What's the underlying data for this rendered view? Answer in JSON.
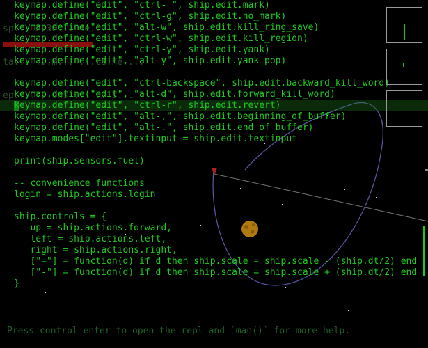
{
  "hud": {
    "lines": [
      "sp... 2.38... 4e...",
      "ta... ...m... ...ta.ne ...",
      "ep.......ons ... ...s..."
    ]
  },
  "editor": {
    "lines": [
      "keymap.define(\"edit\", \"ctrl- \", ship.edit.mark)",
      "keymap.define(\"edit\", \"ctrl-g\", ship.edit.no_mark)",
      "keymap.define(\"edit\", \"alt-w\", ship.edit.kill_ring_save)",
      "keymap.define(\"edit\", \"ctrl-w\", ship.edit.kill_region)",
      "keymap.define(\"edit\", \"ctrl-y\", ship.edit.yank)",
      "keymap.define(\"edit\", \"alt-y\", ship.edit.yank_pop)",
      "",
      "keymap.define(\"edit\", \"ctrl-backspace\", ship.edit.backward_kill_word)",
      "keymap.define(\"edit\", \"alt-d\", ship.edit.forward_kill_word)",
      "keymap.define(\"edit\", \"ctrl-r\", ship.edit.revert)",
      "keymap.define(\"edit\", \"alt-,\", ship.edit.beginning_of_buffer)",
      "keymap.define(\"edit\", \"alt-.\", ship.edit.end_of_buffer)",
      "keymap.modes[\"edit\"].textinput = ship.edit.textinput",
      "",
      "print(ship.sensors.fuel)",
      "",
      "-- convenience functions",
      "login = ship.actions.login",
      "",
      "ship.controls = {",
      "   up = ship.actions.forward,",
      "   left = ship.actions.left,",
      "   right = ship.actions.right,",
      "   [\"=\"] = function(d) if d then ship.scale = ship.scale - (ship.dt/2) end",
      "   [\"-\"] = function(d) if d then ship.scale = ship.scale + (ship.dt/2) end",
      "}"
    ],
    "current_line": 10
  },
  "help": {
    "text": "Press control-enter to open the repl and `man()` for more help."
  },
  "colors": {
    "code": "#1ec81e",
    "orbit": "#5a5aa8",
    "planet": "#b07a10",
    "warning": "#8a1010",
    "ship_marker": "#b02020"
  }
}
